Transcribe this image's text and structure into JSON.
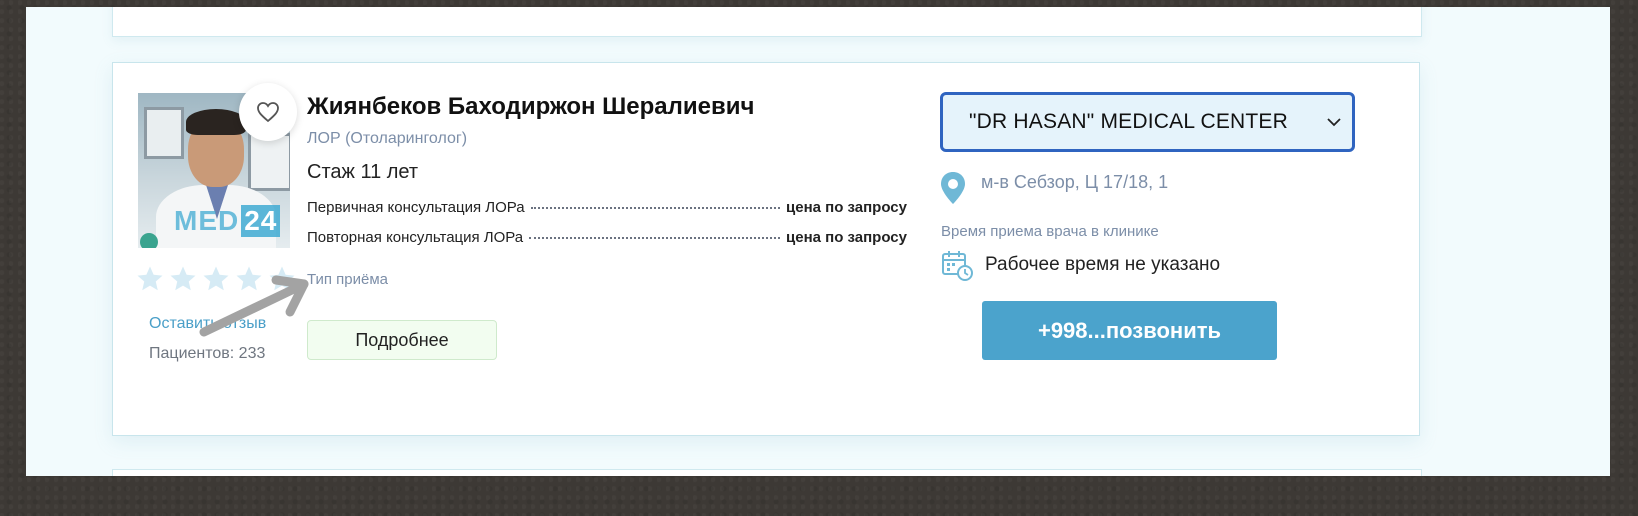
{
  "doctor": {
    "name": "Жиянбеков Баходиржон Шералиевич",
    "specialty": "ЛОР (Отоларинголог)",
    "experience": "Стаж 11 лет",
    "photo_watermark_text": "MED",
    "photo_watermark_badge": "24",
    "rating": {
      "filled": 0,
      "total": 5
    },
    "leave_review_label": "Оставить отзыв",
    "patients_label": "Пациентов: 233"
  },
  "services": [
    {
      "name": "Первичная консультация ЛОРа",
      "price": "цена по запросу"
    },
    {
      "name": "Повторная консультация ЛОРа",
      "price": "цена по запросу"
    }
  ],
  "visit_type_label": "Тип приёма",
  "details_button_label": "Подробнее",
  "clinic": {
    "selected": "\"DR HASAN\" MEDICAL CENTER",
    "address": "м-в Себзор, Ц 17/18, 1",
    "hours_title": "Время приема врача в клинике",
    "hours_value": "Рабочее время не указано"
  },
  "call_button_label": "+998...позвонить",
  "colors": {
    "accent_blue": "#4ba3cc",
    "select_border": "#2f64c0",
    "muted_text": "#7c8ea8",
    "star_empty": "#d6ebf5"
  },
  "icons": {
    "favorite": "heart-outline-icon",
    "dropdown": "chevron-down-icon",
    "location": "map-pin-icon",
    "schedule": "calendar-clock-icon",
    "rating": "star-icon"
  }
}
